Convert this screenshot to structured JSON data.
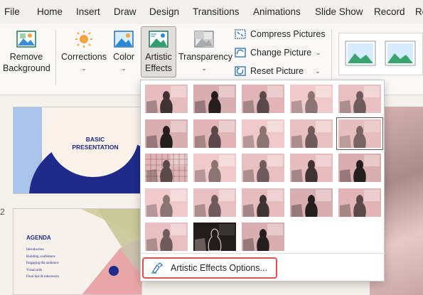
{
  "menu": {
    "tabs": [
      "File",
      "Home",
      "Insert",
      "Draw",
      "Design",
      "Transitions",
      "Animations",
      "Slide Show",
      "Record",
      "Re"
    ]
  },
  "ribbon": {
    "remove_background": [
      "Remove",
      "Background"
    ],
    "corrections": "Corrections",
    "color": "Color",
    "artistic_effects": [
      "Artistic",
      "Effects"
    ],
    "transparency": "Transparency",
    "compress_pictures": "Compress Pictures",
    "change_picture": "Change Picture",
    "reset_picture": "Reset Picture"
  },
  "slides": {
    "slide1": {
      "title": [
        "BASIC",
        "PRESENTATION"
      ]
    },
    "slide2": {
      "title": "AGENDA",
      "items": [
        "Introduction",
        "Building confidence",
        "Engaging the audience",
        "Visual aids",
        "Final tips & takeaways"
      ]
    },
    "numbers": [
      "2"
    ]
  },
  "gallery": {
    "effects_count": 23,
    "selected_index": 9
  },
  "options_button": {
    "label": "Artistic Effects Options..."
  },
  "colors": {
    "accent_navy": "#1f2a8a",
    "thumb_pink": "#e3b8b9",
    "highlight_red": "#d9534f"
  }
}
